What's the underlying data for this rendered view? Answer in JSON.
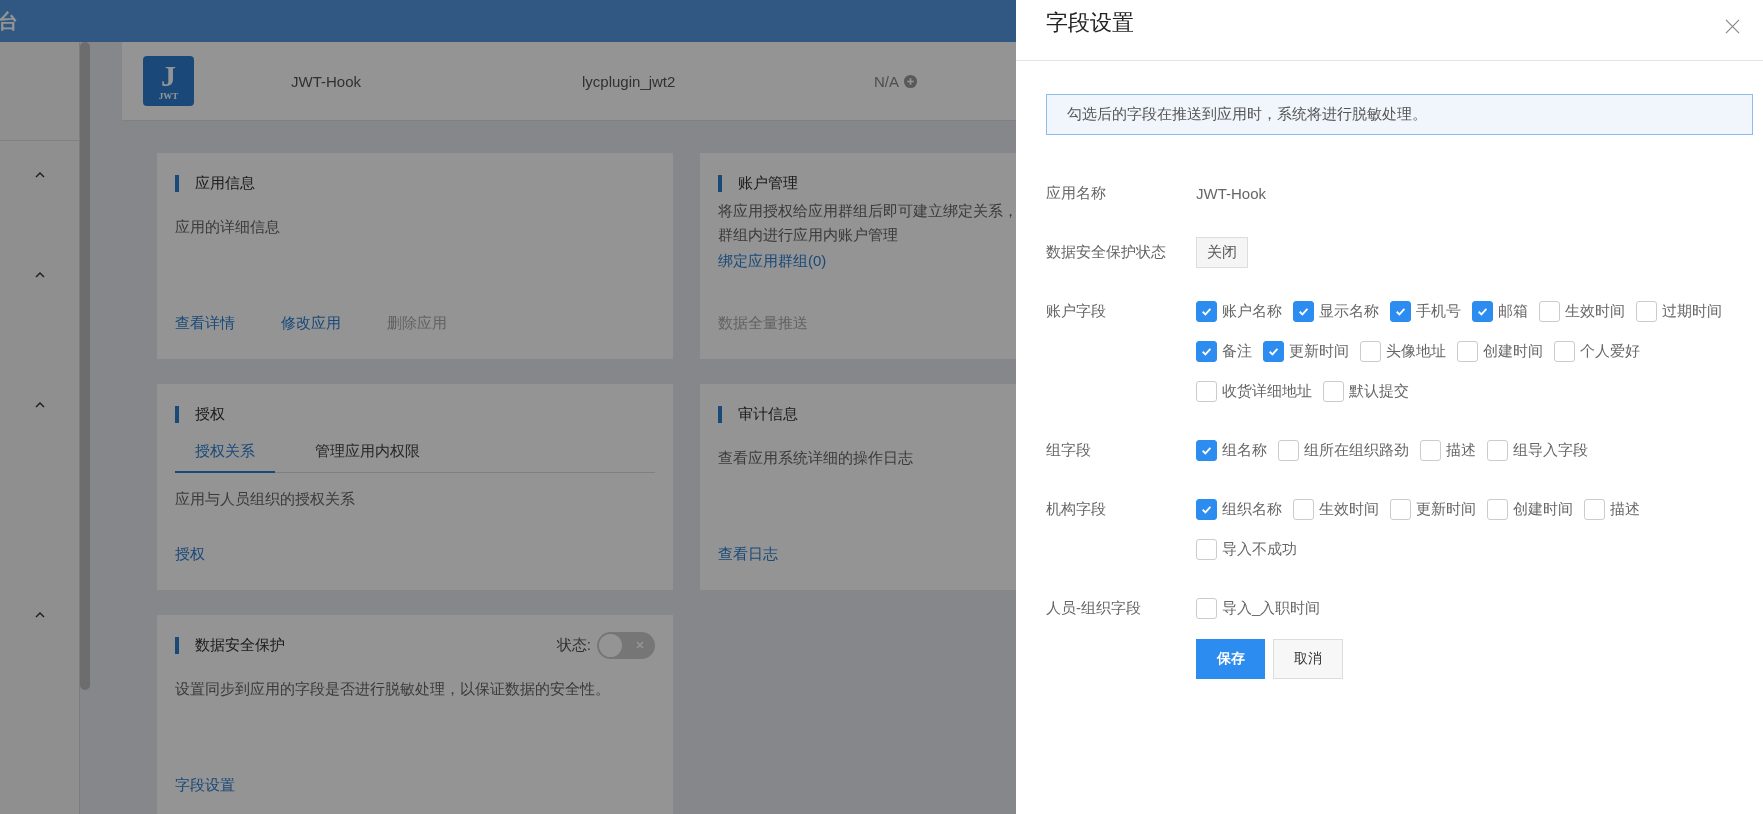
{
  "top_bar": {
    "title": "台"
  },
  "sidebar_groups": [
    {
      "expanded": true
    },
    {
      "expanded": true
    },
    {
      "expanded": true
    },
    {
      "expanded": true
    }
  ],
  "app_header": {
    "logo": {
      "letter": "J",
      "caption": "JWT"
    },
    "name": "JWT-Hook",
    "plugin": "lycplugin_jwt2",
    "status": "N/A"
  },
  "cards": [
    {
      "title": "应用信息",
      "description_lines": [
        "应用的详细信息"
      ],
      "links": [
        {
          "label": "查看详情",
          "disabled": false
        },
        {
          "label": "修改应用",
          "disabled": false
        },
        {
          "label": "删除应用",
          "disabled": true
        }
      ]
    },
    {
      "title": "账户管理",
      "description_lines": [
        "将应用授权给应用群组后即可建立绑定关系，",
        "群组内进行应用内账户管理"
      ],
      "inline_link": "绑定应用群组(0)",
      "links": [
        {
          "label": "数据全量推送",
          "disabled": true
        }
      ]
    },
    {
      "title": "授权",
      "tabs": [
        {
          "label": "授权关系",
          "selected": true
        },
        {
          "label": "管理应用内权限",
          "selected": false
        }
      ],
      "description_lines": [
        "应用与人员组织的授权关系"
      ],
      "links": [
        {
          "label": "授权",
          "disabled": false
        }
      ]
    },
    {
      "title": "审计信息",
      "description_lines": [
        "查看应用系统详细的操作日志"
      ],
      "links": [
        {
          "label": "查看日志",
          "disabled": false
        }
      ]
    },
    {
      "title": "数据安全保护",
      "switch": {
        "label": "状态:",
        "on": false
      },
      "description_lines": [
        "设置同步到应用的字段是否进行脱敏处理，以保证数据的安全性。"
      ],
      "links": [
        {
          "label": "字段设置",
          "disabled": false
        }
      ]
    }
  ],
  "drawer": {
    "title": "字段设置",
    "alert": "勾选后的字段在推送到应用时，系统将进行脱敏处理。",
    "rows": [
      {
        "label": "应用名称",
        "kind": "text",
        "value": "JWT-Hook"
      },
      {
        "label": "数据安全保护状态",
        "kind": "tag",
        "value": "关闭"
      },
      {
        "label": "账户字段",
        "kind": "checkboxes",
        "options": [
          {
            "label": "账户名称",
            "checked": true
          },
          {
            "label": "显示名称",
            "checked": true
          },
          {
            "label": "手机号",
            "checked": true
          },
          {
            "label": "邮箱",
            "checked": true
          },
          {
            "label": "生效时间",
            "checked": false
          },
          {
            "label": "过期时间",
            "checked": false
          },
          {
            "label": "备注",
            "checked": true
          },
          {
            "label": "更新时间",
            "checked": true
          },
          {
            "label": "头像地址",
            "checked": false
          },
          {
            "label": "创建时间",
            "checked": false
          },
          {
            "label": "个人爱好",
            "checked": false
          },
          {
            "label": "收货详细地址",
            "checked": false
          },
          {
            "label": "默认提交",
            "checked": false
          }
        ]
      },
      {
        "label": "组字段",
        "kind": "checkboxes",
        "options": [
          {
            "label": "组名称",
            "checked": true
          },
          {
            "label": "组所在组织路劲",
            "checked": false
          },
          {
            "label": "描述",
            "checked": false
          },
          {
            "label": "组导入字段",
            "checked": false
          }
        ]
      },
      {
        "label": "机构字段",
        "kind": "checkboxes",
        "options": [
          {
            "label": "组织名称",
            "checked": true
          },
          {
            "label": "生效时间",
            "checked": false
          },
          {
            "label": "更新时间",
            "checked": false
          },
          {
            "label": "创建时间",
            "checked": false
          },
          {
            "label": "描述",
            "checked": false
          },
          {
            "label": "导入不成功",
            "checked": false
          }
        ]
      },
      {
        "label": "人员-组织字段",
        "kind": "checkboxes",
        "options": [
          {
            "label": "导入_入职时间",
            "checked": false
          }
        ]
      }
    ],
    "buttons": [
      {
        "label": "保存",
        "primary": true
      },
      {
        "label": "取消",
        "primary": false
      }
    ]
  }
}
